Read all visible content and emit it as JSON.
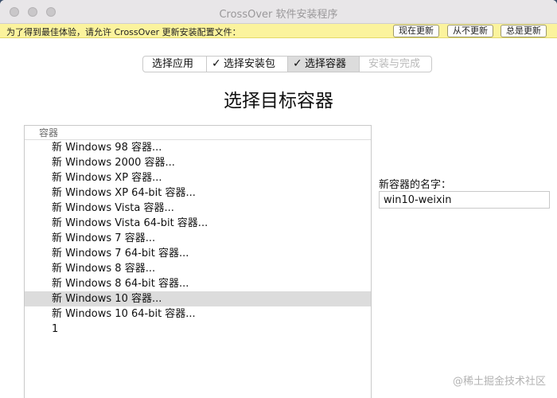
{
  "window": {
    "title": "CrossOver 软件安装程序"
  },
  "notice": {
    "text": "为了得到最佳体验，请允许 CrossOver 更新安装配置文件：",
    "buttons": [
      "现在更新",
      "从不更新",
      "总是更新"
    ]
  },
  "steps": [
    {
      "label": "选择应用",
      "checked": false,
      "active": false,
      "disabled": false
    },
    {
      "label": "选择安装包",
      "checked": true,
      "active": false,
      "disabled": false
    },
    {
      "label": "选择容器",
      "checked": true,
      "active": true,
      "disabled": false
    },
    {
      "label": "安装与完成",
      "checked": false,
      "active": false,
      "disabled": true
    }
  ],
  "check_glyph": "✓",
  "heading": "选择目标容器",
  "list": {
    "header": "容器",
    "items": [
      "新 Windows 98 容器...",
      "新 Windows 2000 容器...",
      "新 Windows XP 容器...",
      "新 Windows XP 64-bit 容器...",
      "新 Windows Vista 容器...",
      "新 Windows Vista 64-bit 容器...",
      "新 Windows 7 容器...",
      "新 Windows 7 64-bit 容器...",
      "新 Windows 8 容器...",
      "新 Windows 8 64-bit 容器...",
      "新 Windows 10 容器...",
      "新 Windows 10 64-bit 容器...",
      "1"
    ],
    "selected_index": 10
  },
  "name_field": {
    "label": "新容器的名字：",
    "value": "win10-weixin"
  },
  "watermark": "@稀土掘金技术社区",
  "colors": {
    "notice_bg": "#fbf39d",
    "selected_bg": "#dcdcdc",
    "disabled_text": "#b9b9b9"
  }
}
